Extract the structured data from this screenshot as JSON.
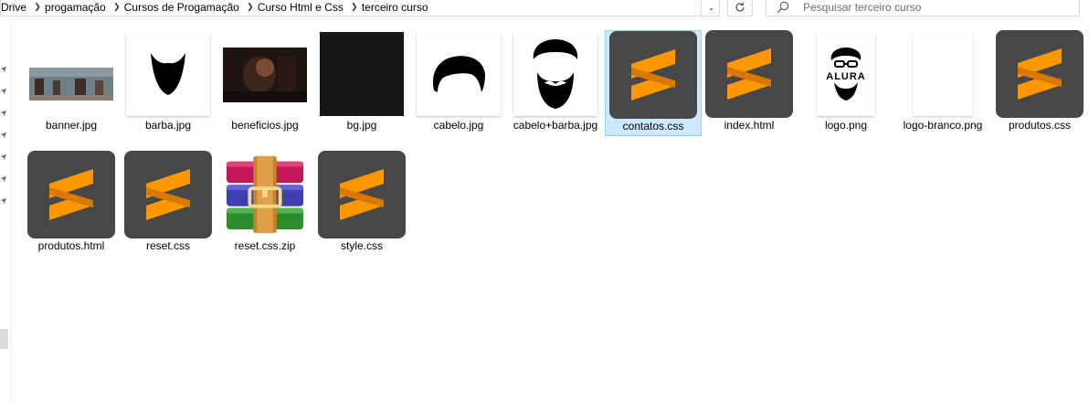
{
  "breadcrumb": [
    "Drive",
    "progamação",
    "Cursos de Progamação",
    "Curso Html e Css",
    "terceiro curso"
  ],
  "search": {
    "placeholder": "Pesquisar terceiro curso"
  },
  "files": [
    {
      "name": "banner.jpg",
      "icon": "image-thumbnail"
    },
    {
      "name": "barba.jpg",
      "icon": "image-thumbnail"
    },
    {
      "name": "beneficios.jpg",
      "icon": "image-thumbnail"
    },
    {
      "name": "bg.jpg",
      "icon": "image-thumbnail"
    },
    {
      "name": "cabelo.jpg",
      "icon": "image-thumbnail"
    },
    {
      "name": "cabelo+barba.jpg",
      "icon": "image-thumbnail"
    },
    {
      "name": "contatos.css",
      "icon": "sublime-text-icon",
      "selected": true
    },
    {
      "name": "index.html",
      "icon": "sublime-text-icon"
    },
    {
      "name": "logo.png",
      "icon": "image-thumbnail",
      "logo_text": "ALURA"
    },
    {
      "name": "logo-branco.png",
      "icon": "image-thumbnail"
    },
    {
      "name": "produtos.css",
      "icon": "sublime-text-icon"
    },
    {
      "name": "produtos.html",
      "icon": "sublime-text-icon"
    },
    {
      "name": "reset.css",
      "icon": "sublime-text-icon"
    },
    {
      "name": "reset.css.zip",
      "icon": "winrar-archive-icon"
    },
    {
      "name": "style.css",
      "icon": "sublime-text-icon"
    }
  ],
  "colors": {
    "sublime_bg": "#474747",
    "sublime_orange": "#ff9800",
    "selection_bg": "#cce8ff",
    "selection_border": "#99d1ff"
  }
}
